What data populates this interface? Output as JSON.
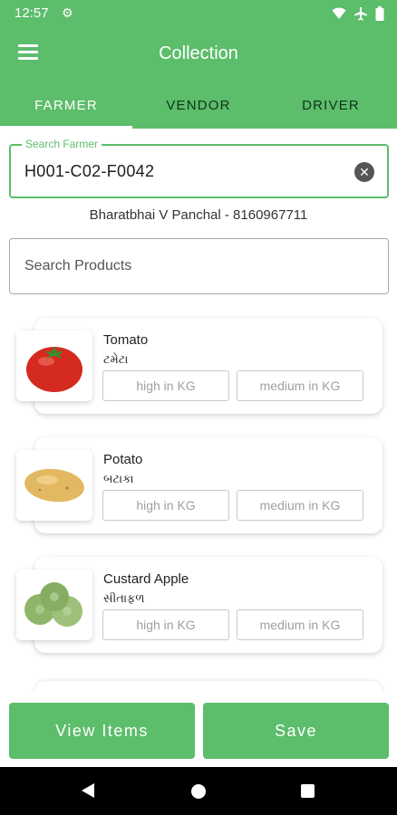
{
  "status_bar": {
    "time": "12:57",
    "icons": [
      "settings-icon",
      "wifi-icon",
      "airplane-icon",
      "battery-icon"
    ]
  },
  "app_bar": {
    "title": "Collection",
    "menu_icon": "hamburger-menu-icon"
  },
  "tabs": [
    {
      "label": "FARMER",
      "active": true
    },
    {
      "label": "VENDOR",
      "active": false
    },
    {
      "label": "DRIVER",
      "active": false
    }
  ],
  "farmer_search": {
    "label": "Search Farmer",
    "value": "H001-C02-F0042",
    "info": "Bharatbhai V Panchal - 8160967711"
  },
  "product_search": {
    "placeholder": "Search Products"
  },
  "products": [
    {
      "name": "Tomato",
      "local_name": "ટમેટા",
      "high_placeholder": "high in KG",
      "medium_placeholder": "medium in KG"
    },
    {
      "name": "Potato",
      "local_name": "બટાકા",
      "high_placeholder": "high in KG",
      "medium_placeholder": "medium in KG"
    },
    {
      "name": "Custard Apple",
      "local_name": "સીતાફળ",
      "high_placeholder": "high in KG",
      "medium_placeholder": "medium in KG"
    }
  ],
  "actions": {
    "view_items": "View Items",
    "save": "Save"
  },
  "colors": {
    "primary": "#5cbd6b",
    "tab_inactive": "#10331a"
  }
}
